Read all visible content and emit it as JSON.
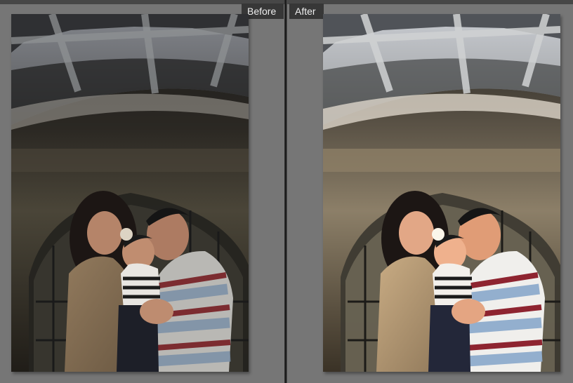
{
  "compare": {
    "before_label": "Before",
    "after_label": "After"
  },
  "photos": {
    "before": {
      "icon": "family-photo-before-icon"
    },
    "after": {
      "icon": "family-photo-after-icon"
    }
  },
  "colors": {
    "background": "#767676",
    "label_bg": "#373737",
    "label_text": "#efefef",
    "divider": "#1d1d1d"
  }
}
